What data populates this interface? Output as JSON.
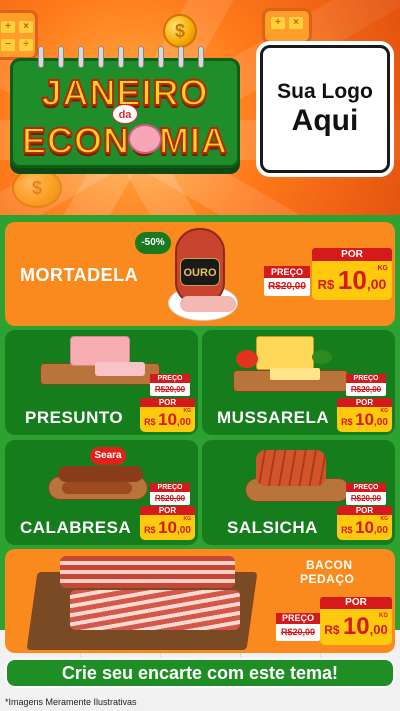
{
  "header": {
    "title_line1": "JANEIRO",
    "title_connector": "da",
    "title_line2": "ECONOMIA",
    "logo_line1": "Sua Logo",
    "logo_line2": "Aqui",
    "calc_keys": [
      "+",
      "×",
      "−",
      "÷"
    ],
    "coin_symbol": "$"
  },
  "products": [
    {
      "name": "MORTADELA",
      "discount": "-50%",
      "preco_label": "PREÇO",
      "old_price": "R$20,00",
      "por_label": "POR",
      "currency": "R$",
      "price_int": "10",
      "price_dec": ",00",
      "unit": "KG",
      "brand": "OURO"
    },
    {
      "name": "PRESUNTO",
      "preco_label": "PREÇO",
      "old_price": "R$20,00",
      "por_label": "POR",
      "currency": "R$",
      "price_int": "10",
      "price_dec": ",00",
      "unit": "KG"
    },
    {
      "name": "MUSSARELA",
      "preco_label": "PREÇO",
      "old_price": "R$20,00",
      "por_label": "POR",
      "currency": "R$",
      "price_int": "10",
      "price_dec": ",00",
      "unit": "KG"
    },
    {
      "name": "CALABRESA",
      "preco_label": "PREÇO",
      "old_price": "R$20,00",
      "por_label": "POR",
      "currency": "R$",
      "price_int": "10",
      "price_dec": ",00",
      "unit": "KG",
      "brand": "Seara"
    },
    {
      "name": "SALSICHA",
      "preco_label": "PREÇO",
      "old_price": "R$20,00",
      "por_label": "POR",
      "currency": "R$",
      "price_int": "10",
      "price_dec": ",00",
      "unit": "KG"
    },
    {
      "name_line1": "BACON",
      "name_line2": "PEDAÇO",
      "preco_label": "PREÇO",
      "old_price": "R$20,00",
      "por_label": "POR",
      "currency": "R$",
      "price_int": "10",
      "price_dec": ",00",
      "unit": "KG"
    }
  ],
  "cta": "Crie seu encarte com este tema!",
  "disclaimer": "*Imagens Meramente Ilustrativas",
  "colors": {
    "orange": "#fb8a1e",
    "green": "#2ea133",
    "dark_green": "#167d1c",
    "red": "#d41a1a",
    "yellow": "#ffc90e"
  }
}
